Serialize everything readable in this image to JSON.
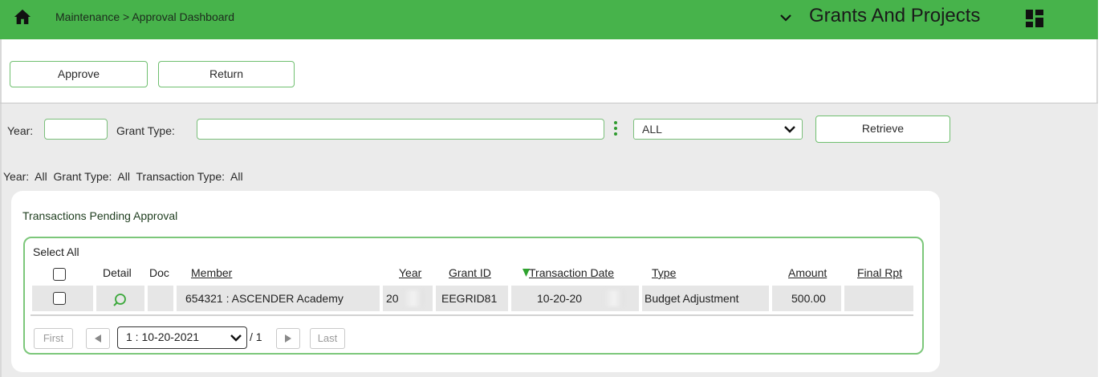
{
  "header": {
    "breadcrumb": "Maintenance > Approval Dashboard",
    "app_title": "Grants And Projects"
  },
  "toolbar": {
    "approve_label": "Approve",
    "return_label": "Return"
  },
  "filters": {
    "year_label": "Year:",
    "year_value": "",
    "grant_type_label": "Grant Type:",
    "grant_type_value": "",
    "transaction_type_selected": "ALL",
    "retrieve_label": "Retrieve",
    "summary": "Year:  All  Grant Type:  All  Transaction Type:  All"
  },
  "grid": {
    "title": "Transactions Pending Approval",
    "select_all_label": "Select All",
    "columns": {
      "detail": "Detail",
      "doc": "Doc",
      "member": "Member",
      "year": "Year",
      "grant_id": "Grant ID",
      "transaction_date": "Transaction Date",
      "type": "Type",
      "amount": "Amount",
      "final_rpt": "Final Rpt"
    },
    "rows": [
      {
        "member": "654321 : ASCENDER Academy",
        "year": "20",
        "grant_id": "EEGRID81",
        "transaction_date": "10-20-20",
        "type": "Budget Adjustment",
        "amount": "500.00",
        "final_rpt": ""
      }
    ]
  },
  "pagination": {
    "first_label": "First",
    "last_label": "Last",
    "page_selected": "1 : 10-20-2021",
    "of_total": "/ 1"
  },
  "colors": {
    "header_green": "#47b34b",
    "border_green": "#7cc77a",
    "filter_bg": "#ebebeb"
  },
  "icons": [
    "home-icon",
    "chevron-down-icon",
    "app-grid-icon",
    "kebab-menu-icon",
    "magnifier-icon",
    "sort-desc-icon",
    "prev-page-icon",
    "next-page-icon"
  ]
}
